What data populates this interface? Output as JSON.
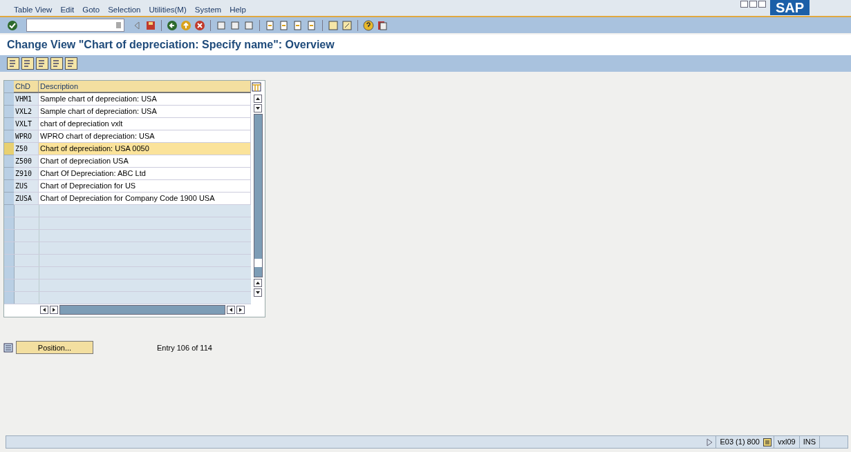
{
  "menu_bar": {
    "items": [
      "Table View",
      "Edit",
      "Goto",
      "Selection",
      "Utilities(M)",
      "System",
      "Help"
    ],
    "logo": "SAP"
  },
  "title": "Change View \"Chart of depreciation: Specify name\": Overview",
  "table": {
    "columns": [
      "ChD",
      "Description"
    ],
    "rows": [
      {
        "code": "VHM1",
        "description": "Sample chart of depreciation: USA",
        "selected": false
      },
      {
        "code": "VXL2",
        "description": "Sample chart of depreciation: USA",
        "selected": false
      },
      {
        "code": "VXLT",
        "description": "chart of depreciation vxlt",
        "selected": false
      },
      {
        "code": "WPRO",
        "description": "WPRO chart of depreciation: USA",
        "selected": false
      },
      {
        "code": "Z50",
        "description": "Chart of depreciation: USA 0050",
        "selected": true
      },
      {
        "code": "Z500",
        "description": "Chart of depreciation USA",
        "selected": false
      },
      {
        "code": "Z910",
        "description": "Chart Of Depreciation: ABC Ltd",
        "selected": false
      },
      {
        "code": "ZUS",
        "description": "Chart of Depreciation for US",
        "selected": false
      },
      {
        "code": "ZUSA",
        "description": "Chart of Depreciation for Company Code 1900  USA",
        "selected": false
      }
    ]
  },
  "position_button": "Position...",
  "entry_info": "Entry 106 of 114",
  "status_bar": {
    "system": "E03 (1) 800",
    "server": "vxl09",
    "mode": "INS"
  }
}
